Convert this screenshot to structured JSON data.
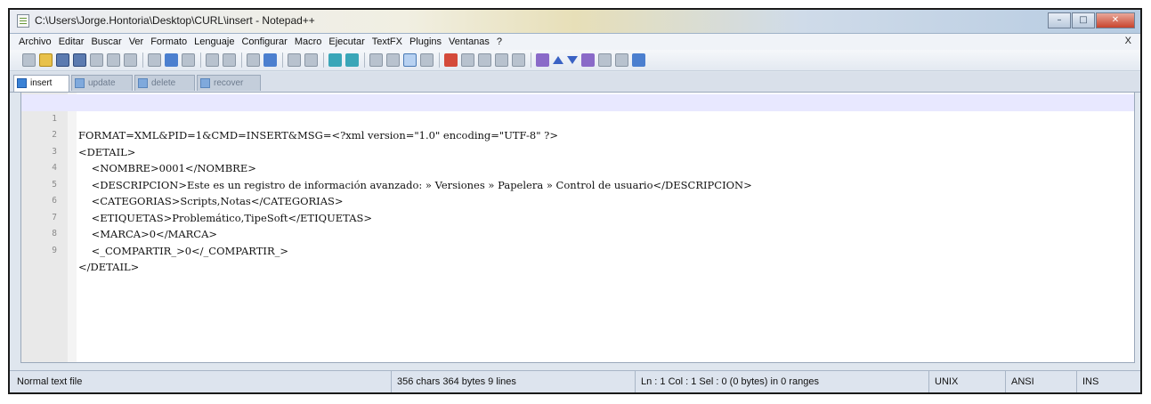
{
  "window": {
    "title": "C:\\Users\\Jorge.Hontoria\\Desktop\\CURL\\insert - Notepad++"
  },
  "menu": {
    "items": [
      "Archivo",
      "Editar",
      "Buscar",
      "Ver",
      "Formato",
      "Lenguaje",
      "Configurar",
      "Macro",
      "Ejecutar",
      "TextFX",
      "Plugins",
      "Ventanas",
      "?"
    ],
    "close_label": "X"
  },
  "tabs": [
    {
      "label": "insert",
      "active": true
    },
    {
      "label": "update",
      "active": false
    },
    {
      "label": "delete",
      "active": false
    },
    {
      "label": "recover",
      "active": false
    }
  ],
  "editor": {
    "lines": [
      {
        "num": "1",
        "text": "FORMAT=XML&PID=1&CMD=INSERT&MSG=<?xml version=\"1.0\" encoding=\"UTF-8\" ?>"
      },
      {
        "num": "2",
        "text": "<DETAIL>"
      },
      {
        "num": "3",
        "text": "    <NOMBRE>0001</NOMBRE>"
      },
      {
        "num": "4",
        "text": "    <DESCRIPCION>Este es un registro de información avanzado: » Versiones » Papelera » Control de usuario</DESCRIPCION>"
      },
      {
        "num": "5",
        "text": "    <CATEGORIAS>Scripts,Notas</CATEGORIAS>"
      },
      {
        "num": "6",
        "text": "    <ETIQUETAS>Problemático,TipeSoft</ETIQUETAS>"
      },
      {
        "num": "7",
        "text": "    <MARCA>0</MARCA>"
      },
      {
        "num": "8",
        "text": "    <_COMPARTIR_>0</_COMPARTIR_>"
      },
      {
        "num": "9",
        "text": "</DETAIL>"
      }
    ]
  },
  "status": {
    "file_type": "Normal text file",
    "size_info": "356 chars  364 bytes  9 lines",
    "position": "Ln : 1    Col : 1    Sel : 0 (0 bytes) in 0 ranges",
    "eol": "UNIX",
    "encoding": "ANSI",
    "mode": "INS"
  }
}
